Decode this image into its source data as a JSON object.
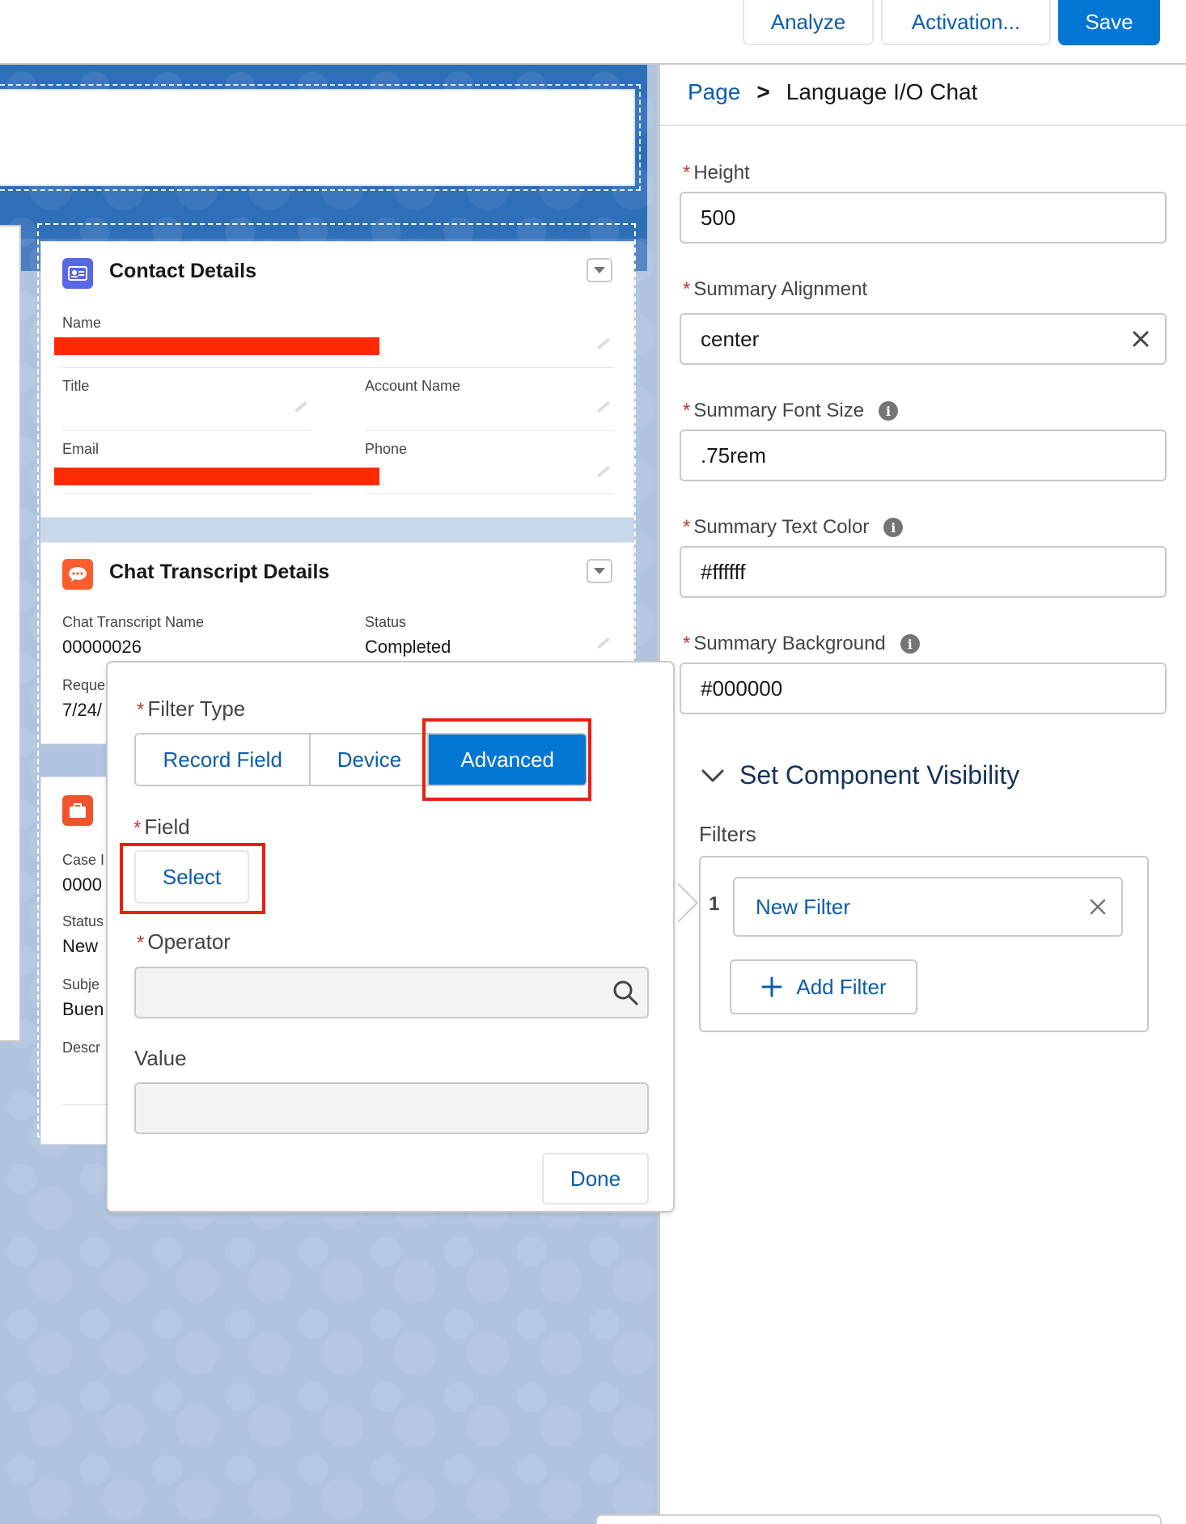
{
  "toolbar": {
    "analyze_label": "Analyze",
    "activation_label": "Activation...",
    "save_label": "Save"
  },
  "contact_card": {
    "title": "Contact Details",
    "fields": {
      "name_label": "Name",
      "title_label": "Title",
      "account_label": "Account Name",
      "email_label": "Email",
      "phone_label": "Phone"
    }
  },
  "chat_card": {
    "title": "Chat Transcript Details",
    "name_label": "Chat Transcript Name",
    "name_value": "00000026",
    "status_label": "Status",
    "status_value": "Completed",
    "requested_label": "Reque",
    "requested_value": "7/24/"
  },
  "case_card": {
    "case_label": "Case I",
    "case_value": "0000",
    "status_label": "Status",
    "status_value": "New",
    "subject_label": "Subje",
    "subject_value": "Buen",
    "description_label": "Descr"
  },
  "popover": {
    "filter_type_label": "Filter Type",
    "segments": [
      "Record Field",
      "Device",
      "Advanced"
    ],
    "selected_segment": "Advanced",
    "field_label": "Field",
    "select_label": "Select",
    "operator_label": "Operator",
    "value_label": "Value",
    "done_label": "Done"
  },
  "panel": {
    "breadcrumb": {
      "root": "Page",
      "separator": ">",
      "current": "Language I/O Chat"
    },
    "height": {
      "label": "Height",
      "value": "500"
    },
    "summary_alignment": {
      "label": "Summary Alignment",
      "value": "center"
    },
    "summary_font_size": {
      "label": "Summary Font Size",
      "value": ".75rem"
    },
    "summary_text_color": {
      "label": "Summary Text Color",
      "value": "#ffffff"
    },
    "summary_background": {
      "label": "Summary Background",
      "value": "#000000"
    },
    "visibility": {
      "section_title": "Set Component Visibility",
      "filters_label": "Filters",
      "filters": [
        {
          "index": "1",
          "label": "New Filter"
        }
      ],
      "add_filter_label": "Add Filter"
    }
  },
  "colors": {
    "brand": "#0176d3",
    "link": "#0b5cab",
    "canvas": "#b0c4df",
    "highlight": "#ea1f10",
    "redaction": "#ff2a00",
    "required": "#c23934"
  },
  "icons": {
    "contact": "contact-card-icon",
    "chat": "chat-bubble-icon",
    "case": "briefcase-icon",
    "menu": "chevron-down-icon",
    "search": "search-icon",
    "clear": "close-icon",
    "info": "info-icon",
    "add": "plus-icon"
  }
}
